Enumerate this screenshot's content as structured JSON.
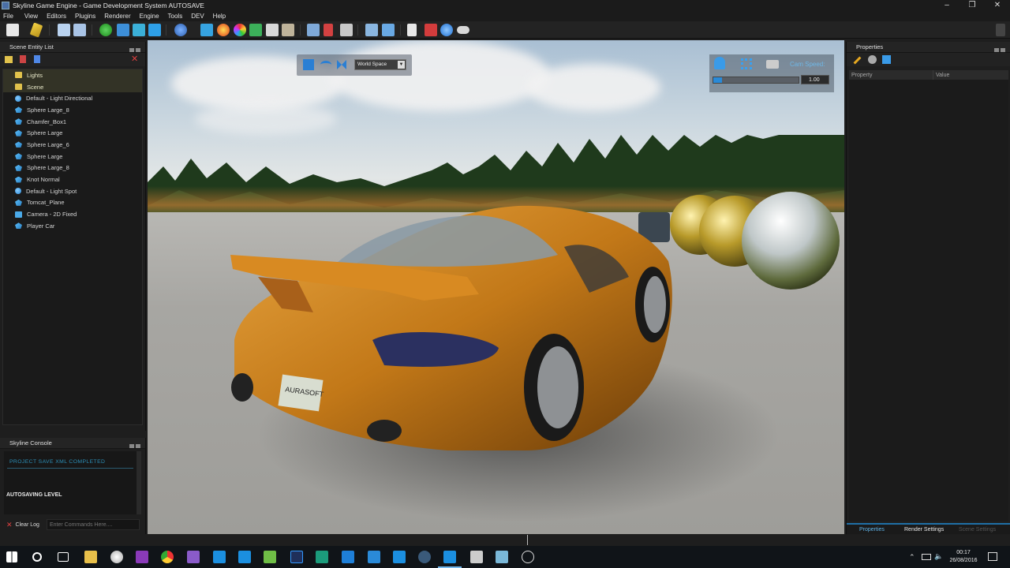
{
  "window": {
    "title": "Skyline Game Engine - Game Development System AUTOSAVE"
  },
  "menu": [
    "File",
    "View",
    "Editors",
    "Plugins",
    "Renderer",
    "Engine",
    "Tools",
    "DEV",
    "Help"
  ],
  "colors": {
    "accent": "#2a8ad8",
    "folder": "#e1c24c",
    "console_text": "#2b8fb8",
    "error_x": "#e04040"
  },
  "left_panel": {
    "title": "Scene Entity List",
    "entities": [
      {
        "label": "Lights",
        "kind": "folder"
      },
      {
        "label": "Scene",
        "kind": "folder"
      },
      {
        "label": "Default - Light  Directional",
        "kind": "light"
      },
      {
        "label": "Sphere Large_8",
        "kind": "mesh"
      },
      {
        "label": "Chamfer_Box1",
        "kind": "mesh"
      },
      {
        "label": "Sphere Large",
        "kind": "mesh"
      },
      {
        "label": "Sphere Large_6",
        "kind": "mesh"
      },
      {
        "label": "Sphere Large",
        "kind": "mesh"
      },
      {
        "label": "Sphere Large_8",
        "kind": "mesh"
      },
      {
        "label": "Knot Normal",
        "kind": "mesh"
      },
      {
        "label": "Default - Light  Spot",
        "kind": "light"
      },
      {
        "label": "Tomcat_Plane",
        "kind": "mesh"
      },
      {
        "label": "Camera - 2D Fixed",
        "kind": "camera"
      },
      {
        "label": "Player Car",
        "kind": "mesh"
      }
    ]
  },
  "console": {
    "title": "Skyline Console",
    "log_line1": "PROJECT SAVE XML COMPLETED",
    "log_line2": "AUTOSAVING LEVEL",
    "clear_label": "Clear Log",
    "input_placeholder": "Enter Commands Here...."
  },
  "viewport": {
    "space_select": "World Space",
    "cam_speed_label": "Cam Speed:",
    "cam_speed_value": "1.00",
    "cam_speed_fraction": 0.1,
    "license_plate": "AURASOFT"
  },
  "right_panel": {
    "title": "Properties",
    "columns": [
      "Property",
      "Value"
    ],
    "tabs": [
      "Properties",
      "Render Settings",
      "Scene Settings"
    ]
  },
  "taskbar": {
    "time": "00:17",
    "date": "26/08/2016"
  }
}
